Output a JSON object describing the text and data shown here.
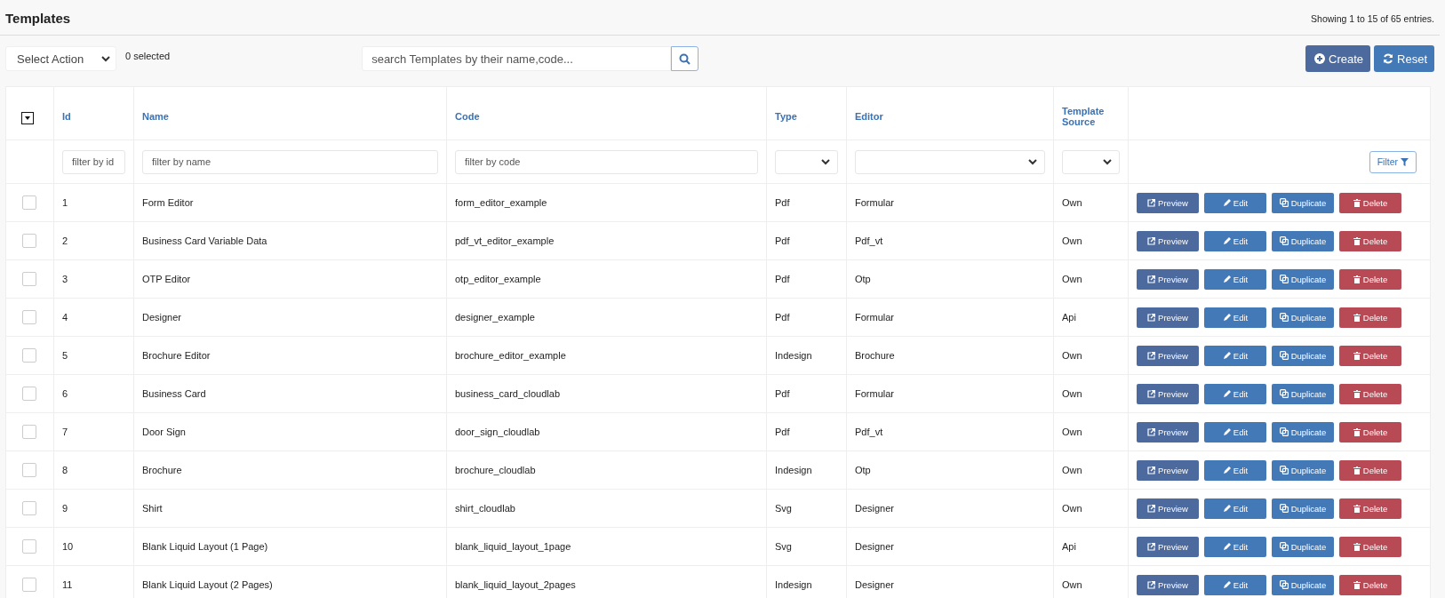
{
  "header": {
    "title": "Templates",
    "entries_info": "Showing 1 to 15 of 65 entries."
  },
  "toolbar": {
    "action_select": {
      "value": "Select Action"
    },
    "selected_count": "0 selected",
    "search": {
      "placeholder": "search Templates by their name,code..."
    },
    "buttons": [
      {
        "kind": "create",
        "label": "Create"
      },
      {
        "kind": "reset",
        "label": "Reset"
      }
    ]
  },
  "table": {
    "columns": [
      "Id",
      "Name",
      "Code",
      "Type",
      "Editor",
      "Template Source"
    ],
    "filters": [
      {
        "kind": "input",
        "placeholder": "filter by id"
      },
      {
        "kind": "input",
        "placeholder": "filter by name"
      },
      {
        "kind": "input",
        "placeholder": "filter by code"
      },
      {
        "kind": "select"
      },
      {
        "kind": "select"
      },
      {
        "kind": "select"
      }
    ],
    "filter_button": "Filter",
    "rows": [
      {
        "checked": false,
        "cells": [
          "1",
          "Form Editor",
          "form_editor_example",
          "Pdf",
          "Formular",
          "Own"
        ],
        "actions": [
          "Preview",
          "Edit",
          "Duplicate",
          "Delete"
        ]
      },
      {
        "checked": false,
        "cells": [
          "2",
          "Business Card Variable Data",
          "pdf_vt_editor_example",
          "Pdf",
          "Pdf_vt",
          "Own"
        ],
        "actions": [
          "Preview",
          "Edit",
          "Duplicate",
          "Delete"
        ]
      },
      {
        "checked": false,
        "cells": [
          "3",
          "OTP Editor",
          "otp_editor_example",
          "Pdf",
          "Otp",
          "Own"
        ],
        "actions": [
          "Preview",
          "Edit",
          "Duplicate",
          "Delete"
        ]
      },
      {
        "checked": false,
        "cells": [
          "4",
          "Designer",
          "designer_example",
          "Pdf",
          "Formular",
          "Api"
        ],
        "actions": [
          "Preview",
          "Edit",
          "Duplicate",
          "Delete"
        ]
      },
      {
        "checked": false,
        "cells": [
          "5",
          "Brochure Editor",
          "brochure_editor_example",
          "Indesign",
          "Brochure",
          "Own"
        ],
        "actions": [
          "Preview",
          "Edit",
          "Duplicate",
          "Delete"
        ]
      },
      {
        "checked": false,
        "cells": [
          "6",
          "Business Card",
          "business_card_cloudlab",
          "Pdf",
          "Formular",
          "Own"
        ],
        "actions": [
          "Preview",
          "Edit",
          "Duplicate",
          "Delete"
        ]
      },
      {
        "checked": false,
        "cells": [
          "7",
          "Door Sign",
          "door_sign_cloudlab",
          "Pdf",
          "Pdf_vt",
          "Own"
        ],
        "actions": [
          "Preview",
          "Edit",
          "Duplicate",
          "Delete"
        ]
      },
      {
        "checked": false,
        "cells": [
          "8",
          "Brochure",
          "brochure_cloudlab",
          "Indesign",
          "Otp",
          "Own"
        ],
        "actions": [
          "Preview",
          "Edit",
          "Duplicate",
          "Delete"
        ]
      },
      {
        "checked": false,
        "cells": [
          "9",
          "Shirt",
          "shirt_cloudlab",
          "Svg",
          "Designer",
          "Own"
        ],
        "actions": [
          "Preview",
          "Edit",
          "Duplicate",
          "Delete"
        ]
      },
      {
        "checked": false,
        "cells": [
          "10",
          "Blank Liquid Layout (1 Page)",
          "blank_liquid_layout_1page",
          "Svg",
          "Designer",
          "Api"
        ],
        "actions": [
          "Preview",
          "Edit",
          "Duplicate",
          "Delete"
        ]
      },
      {
        "checked": false,
        "cells": [
          "11",
          "Blank Liquid Layout (2 Pages)",
          "blank_liquid_layout_2pages",
          "Indesign",
          "Designer",
          "Own"
        ],
        "actions": [
          "Preview",
          "Edit",
          "Duplicate",
          "Delete"
        ]
      }
    ]
  }
}
